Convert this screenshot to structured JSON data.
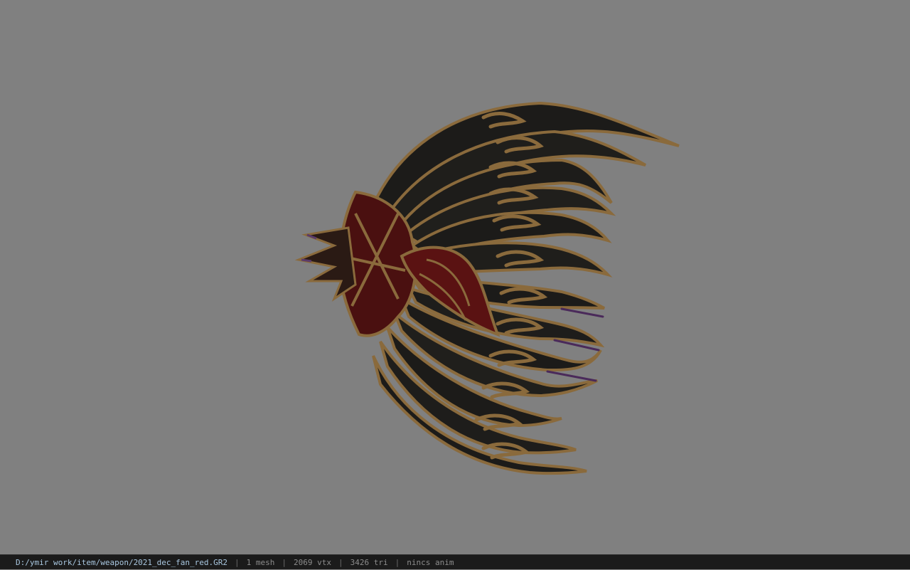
{
  "viewport": {
    "background": "#808080",
    "model_colors": {
      "feather_dark": "#1e1d1b",
      "gold_trim": "#8a6a3c",
      "crimson": "#5a1212",
      "purple_tip": "#4a2a5a"
    }
  },
  "status_bar": {
    "file_path": "D:/ymir work/item/weapon/2021_dec_fan_red.GR2",
    "separator": "|",
    "mesh_count": "1 mesh",
    "vertex_count": "2069 vtx",
    "triangle_count": "3426 tri",
    "anim_status": "nincs anim"
  }
}
